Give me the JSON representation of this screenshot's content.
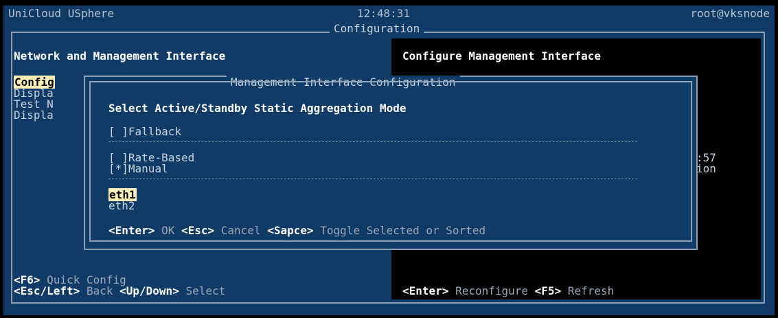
{
  "header": {
    "app": "UniCloud USphere",
    "time": "12:48:31",
    "user": "root@vksnode",
    "section": "Configuration"
  },
  "left_panel": {
    "title": "Network and Management Interface",
    "items": [
      "Config",
      "Displa",
      "Test N",
      "Displa"
    ],
    "footer1_key": "<F6>",
    "footer1_text": " Quick Config",
    "footer2_key1": "<Esc/Left>",
    "footer2_text1": " Back ",
    "footer2_key2": "<Up/Down>",
    "footer2_text2": " Select"
  },
  "right_panel": {
    "title": "Configure Management Interface",
    "partial1": ":57",
    "partial2": "ion",
    "footer_key1": "<Enter>",
    "footer_text1": " Reconfigure ",
    "footer_key2": "<F5>",
    "footer_text2": " Refresh"
  },
  "dialog": {
    "title": "Management Interface Configuration",
    "heading": "Select Active/Standby Static Aggregation Mode",
    "options": [
      {
        "mark": "[ ]",
        "label": "Fallback"
      },
      {
        "mark": "[ ]",
        "label": "Rate-Based"
      },
      {
        "mark": "[*]",
        "label": "Manual"
      }
    ],
    "nics": [
      "eth1",
      "eth2"
    ],
    "footer": {
      "k1": "<Enter>",
      "t1": " OK ",
      "k2": "<Esc>",
      "t2": " Cancel ",
      "k3": "<Sapce>",
      "t3": " Toggle Selected or Sorted"
    }
  },
  "colors": {
    "panel_blue": "#0f3b66",
    "highlight": "#fff2b8",
    "border": "#8aa0b6"
  }
}
